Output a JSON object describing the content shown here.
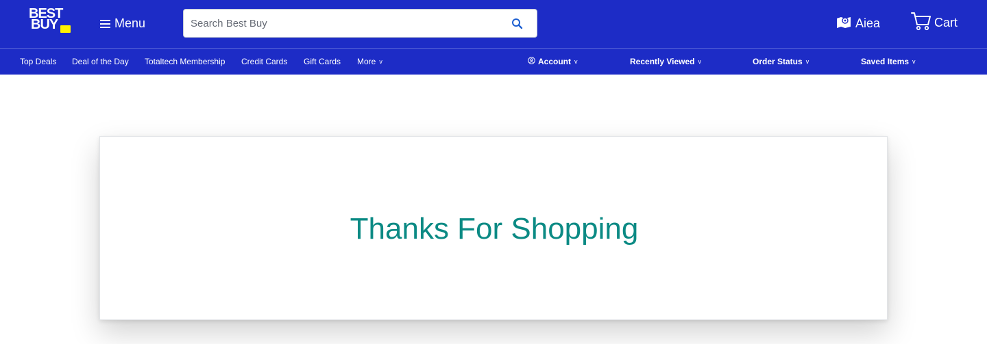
{
  "brand": {
    "logo_line1": "BEST",
    "logo_line2": "BUY",
    "colors": {
      "header": "#1d2cc6",
      "tag": "#fff200",
      "accent_text": "#0b8a84"
    }
  },
  "header": {
    "menu_label": "Menu",
    "search": {
      "placeholder": "Search Best Buy",
      "value": ""
    },
    "store_label": "Aiea",
    "cart_label": "Cart"
  },
  "nav": {
    "left": [
      {
        "label": "Top Deals"
      },
      {
        "label": "Deal of the Day"
      },
      {
        "label": "Totaltech Membership"
      },
      {
        "label": "Credit Cards"
      },
      {
        "label": "Gift Cards"
      },
      {
        "label": "More",
        "caret": "v"
      }
    ],
    "right": [
      {
        "label": "Account",
        "caret": "v",
        "icon": "account-circle-icon"
      },
      {
        "label": "Recently Viewed",
        "caret": "v"
      },
      {
        "label": "Order Status",
        "caret": "v"
      },
      {
        "label": "Saved Items",
        "caret": "v"
      }
    ]
  },
  "main": {
    "message": "Thanks For Shopping"
  }
}
